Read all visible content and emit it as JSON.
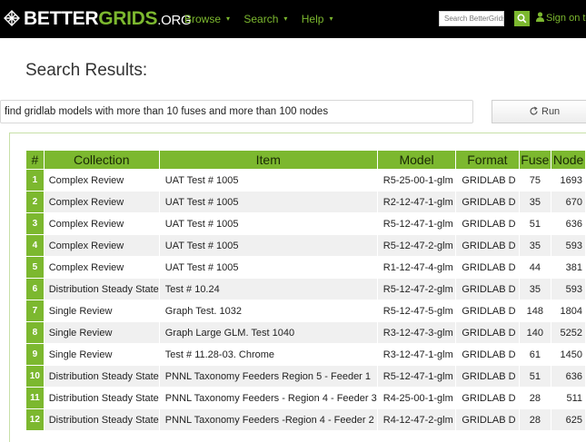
{
  "navbar": {
    "logo_part1": "BETTER",
    "logo_part2": "GRIDS",
    "logo_part3": ".ORG",
    "menu": [
      "Browse",
      "Search",
      "Help"
    ],
    "search_placeholder": "Search BetterGrids",
    "signin_label": "Sign on to"
  },
  "page": {
    "heading": "Search Results:"
  },
  "query": {
    "value": "find gridlab models with more than 10 fuses and more than 100 nodes",
    "run_label": "Run"
  },
  "table": {
    "headers": [
      "#",
      "Collection",
      "Item",
      "Model",
      "Format",
      "Fuse",
      "Node"
    ],
    "rows": [
      [
        "1",
        "Complex Review",
        "UAT Test # 1005",
        "R5-25-00-1-glm",
        "GRIDLAB D",
        "75",
        "1693"
      ],
      [
        "2",
        "Complex Review",
        "UAT Test # 1005",
        "R2-12-47-1-glm",
        "GRIDLAB D",
        "35",
        "670"
      ],
      [
        "3",
        "Complex Review",
        "UAT Test # 1005",
        "R5-12-47-1-glm",
        "GRIDLAB D",
        "51",
        "636"
      ],
      [
        "4",
        "Complex Review",
        "UAT Test # 1005",
        "R5-12-47-2-glm",
        "GRIDLAB D",
        "35",
        "593"
      ],
      [
        "5",
        "Complex Review",
        "UAT Test # 1005",
        "R1-12-47-4-glm",
        "GRIDLAB D",
        "44",
        "381"
      ],
      [
        "6",
        "Distribution Steady State",
        "Test # 10.24",
        "R5-12-47-2-glm",
        "GRIDLAB D",
        "35",
        "593"
      ],
      [
        "7",
        "Single Review",
        "Graph Test. 1032",
        "R5-12-47-5-glm",
        "GRIDLAB D",
        "148",
        "1804"
      ],
      [
        "8",
        "Single Review",
        "Graph Large GLM. Test 1040",
        "R3-12-47-3-glm",
        "GRIDLAB D",
        "140",
        "5252"
      ],
      [
        "9",
        "Single Review",
        "Test # 11.28-03. Chrome",
        "R3-12-47-1-glm",
        "GRIDLAB D",
        "61",
        "1450"
      ],
      [
        "10",
        "Distribution Steady State",
        "PNNL Taxonomy Feeders Region 5 - Feeder 1",
        "R5-12-47-1-glm",
        "GRIDLAB D",
        "51",
        "636"
      ],
      [
        "11",
        "Distribution Steady State",
        "PNNL Taxonomy Feeders - Region 4 - Feeder 3",
        "R4-25-00-1-glm",
        "GRIDLAB D",
        "28",
        "511"
      ],
      [
        "12",
        "Distribution Steady State",
        "PNNL Taxonomy Feeders -Region 4 - Feeder 2",
        "R4-12-47-2-glm",
        "GRIDLAB D",
        "28",
        "625"
      ]
    ]
  },
  "colors": {
    "brand_green": "#7cb82f",
    "navbar_bg": "#000000",
    "row_alt": "#f0f0f0"
  },
  "icons": {
    "logo": "grid-logo-icon",
    "search": "search-icon",
    "user": "user-icon",
    "run": "refresh-icon"
  }
}
